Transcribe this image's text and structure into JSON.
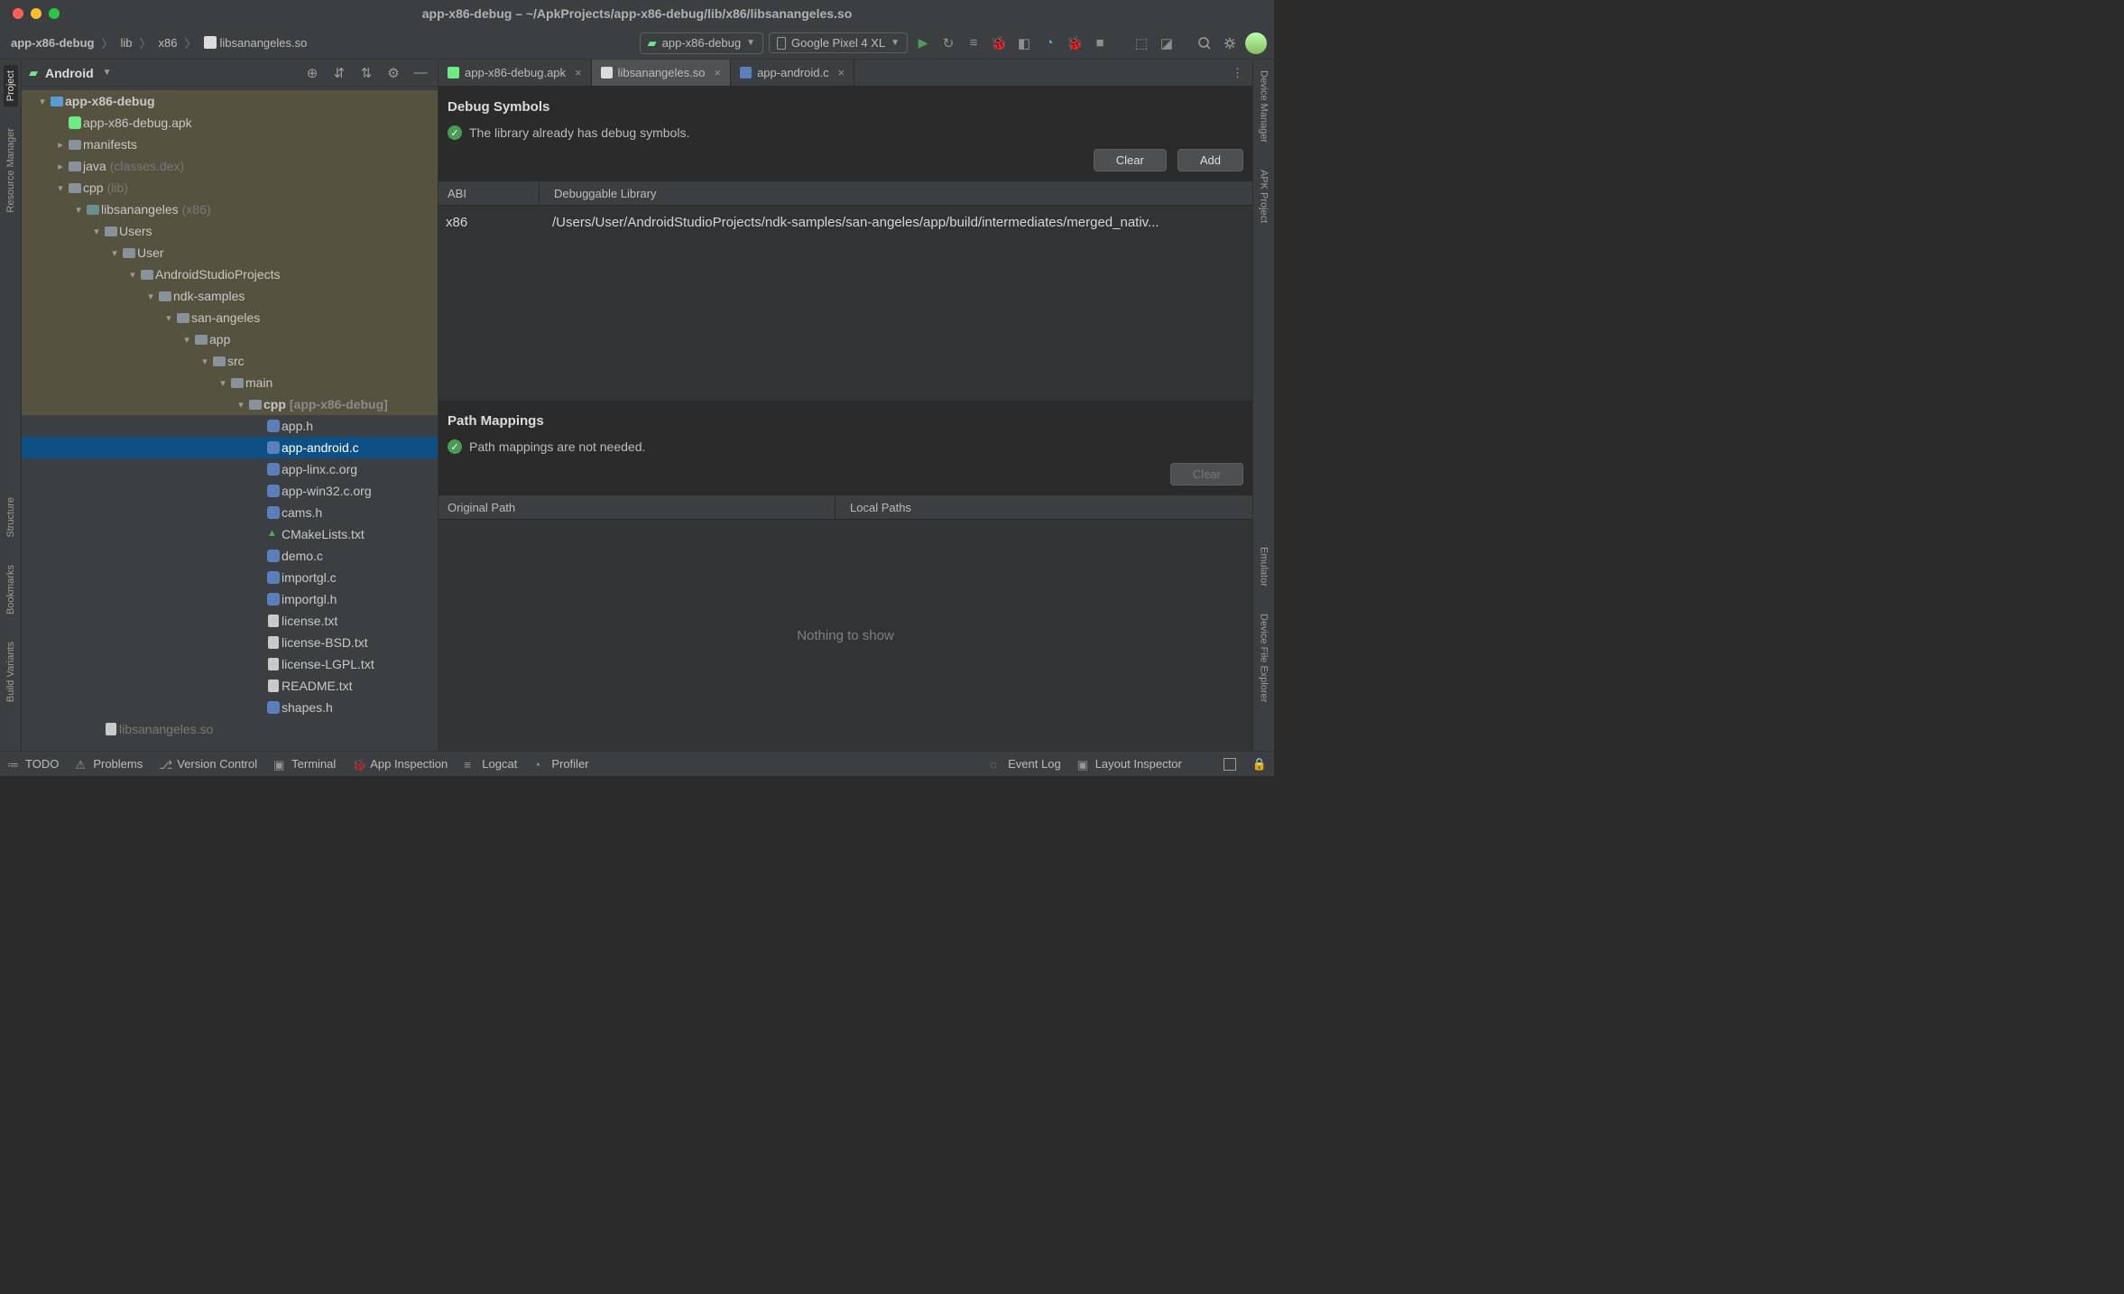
{
  "window": {
    "title": "app-x86-debug – ~/ApkProjects/app-x86-debug/lib/x86/libsanangeles.so"
  },
  "toolbar": {
    "breadcrumb": [
      "app-x86-debug",
      "lib",
      "x86",
      "libsanangeles.so"
    ],
    "run_config": "app-x86-debug",
    "device": "Google Pixel 4 XL"
  },
  "left_rail": [
    "Project",
    "Resource Manager",
    "Structure",
    "Bookmarks",
    "Build Variants"
  ],
  "right_rail": [
    "Device Manager",
    "APK Project",
    "Emulator",
    "Device File Explorer"
  ],
  "project_panel": {
    "title": "Android"
  },
  "tree": [
    {
      "depth": 0,
      "arrow": "▾",
      "icon": "mod",
      "label": "app-x86-debug",
      "bold": true,
      "hl": true
    },
    {
      "depth": 1,
      "arrow": "",
      "icon": "apk",
      "label": "app-x86-debug.apk",
      "hl": true
    },
    {
      "depth": 1,
      "arrow": "▸",
      "icon": "folder",
      "label": "manifests",
      "hl": true
    },
    {
      "depth": 1,
      "arrow": "▸",
      "icon": "folder",
      "label": "java",
      "hint": "(classes.dex)",
      "hl": true
    },
    {
      "depth": 1,
      "arrow": "▾",
      "icon": "folder",
      "label": "cpp",
      "hint": "(lib)",
      "hl": true
    },
    {
      "depth": 2,
      "arrow": "▾",
      "icon": "cpp",
      "label": "libsanangeles",
      "hint": "(x86)",
      "hl": true
    },
    {
      "depth": 3,
      "arrow": "▾",
      "icon": "folder",
      "label": "Users",
      "hl": true
    },
    {
      "depth": 4,
      "arrow": "▾",
      "icon": "folder",
      "label": "User",
      "hl": true
    },
    {
      "depth": 5,
      "arrow": "▾",
      "icon": "folder",
      "label": "AndroidStudioProjects",
      "hl": true
    },
    {
      "depth": 6,
      "arrow": "▾",
      "icon": "folder",
      "label": "ndk-samples",
      "hl": true
    },
    {
      "depth": 7,
      "arrow": "▾",
      "icon": "folder",
      "label": "san-angeles",
      "hl": true
    },
    {
      "depth": 8,
      "arrow": "▾",
      "icon": "folder",
      "label": "app",
      "hl": true
    },
    {
      "depth": 9,
      "arrow": "▾",
      "icon": "folder",
      "label": "src",
      "hl": true
    },
    {
      "depth": 10,
      "arrow": "▾",
      "icon": "folder",
      "label": "main",
      "hl": true
    },
    {
      "depth": 11,
      "arrow": "▾",
      "icon": "folder",
      "label": "cpp",
      "hint": "[app-x86-debug]",
      "hl": true,
      "bold": true,
      "bracket": true
    },
    {
      "depth": 12,
      "arrow": "",
      "icon": "h",
      "label": "app.h"
    },
    {
      "depth": 12,
      "arrow": "",
      "icon": "c",
      "label": "app-android.c",
      "selected": true
    },
    {
      "depth": 12,
      "arrow": "",
      "icon": "c",
      "label": "app-linx.c.org"
    },
    {
      "depth": 12,
      "arrow": "",
      "icon": "c",
      "label": "app-win32.c.org"
    },
    {
      "depth": 12,
      "arrow": "",
      "icon": "h",
      "label": "cams.h"
    },
    {
      "depth": 12,
      "arrow": "",
      "icon": "cmake",
      "label": "CMakeLists.txt"
    },
    {
      "depth": 12,
      "arrow": "",
      "icon": "c",
      "label": "demo.c"
    },
    {
      "depth": 12,
      "arrow": "",
      "icon": "c",
      "label": "importgl.c"
    },
    {
      "depth": 12,
      "arrow": "",
      "icon": "h",
      "label": "importgl.h"
    },
    {
      "depth": 12,
      "arrow": "",
      "icon": "txt",
      "label": "license.txt"
    },
    {
      "depth": 12,
      "arrow": "",
      "icon": "txt",
      "label": "license-BSD.txt"
    },
    {
      "depth": 12,
      "arrow": "",
      "icon": "txt",
      "label": "license-LGPL.txt"
    },
    {
      "depth": 12,
      "arrow": "",
      "icon": "txt",
      "label": "README.txt"
    },
    {
      "depth": 12,
      "arrow": "",
      "icon": "h",
      "label": "shapes.h"
    },
    {
      "depth": 3,
      "arrow": "",
      "icon": "txt",
      "label": "libsanangeles.so",
      "dim": true
    }
  ],
  "editor": {
    "tabs": [
      {
        "icon": "apk",
        "label": "app-x86-debug.apk",
        "active": false
      },
      {
        "icon": "file",
        "label": "libsanangeles.so",
        "active": true
      },
      {
        "icon": "c",
        "label": "app-android.c",
        "active": false
      }
    ],
    "debug_symbols": {
      "title": "Debug Symbols",
      "status": "The library already has debug symbols.",
      "clear_btn": "Clear",
      "add_btn": "Add",
      "headers": {
        "abi": "ABI",
        "lib": "Debuggable Library"
      },
      "rows": [
        {
          "abi": "x86",
          "path": "/Users/User/AndroidStudioProjects/ndk-samples/san-angeles/app/build/intermediates/merged_nativ..."
        }
      ]
    },
    "path_mappings": {
      "title": "Path Mappings",
      "status": "Path mappings are not needed.",
      "clear_btn": "Clear",
      "headers": {
        "orig": "Original Path",
        "local": "Local Paths"
      },
      "empty": "Nothing to show"
    }
  },
  "status_bar": {
    "left": [
      "TODO",
      "Problems",
      "Version Control",
      "Terminal",
      "App Inspection",
      "Logcat",
      "Profiler"
    ],
    "right": [
      "Event Log",
      "Layout Inspector"
    ]
  }
}
